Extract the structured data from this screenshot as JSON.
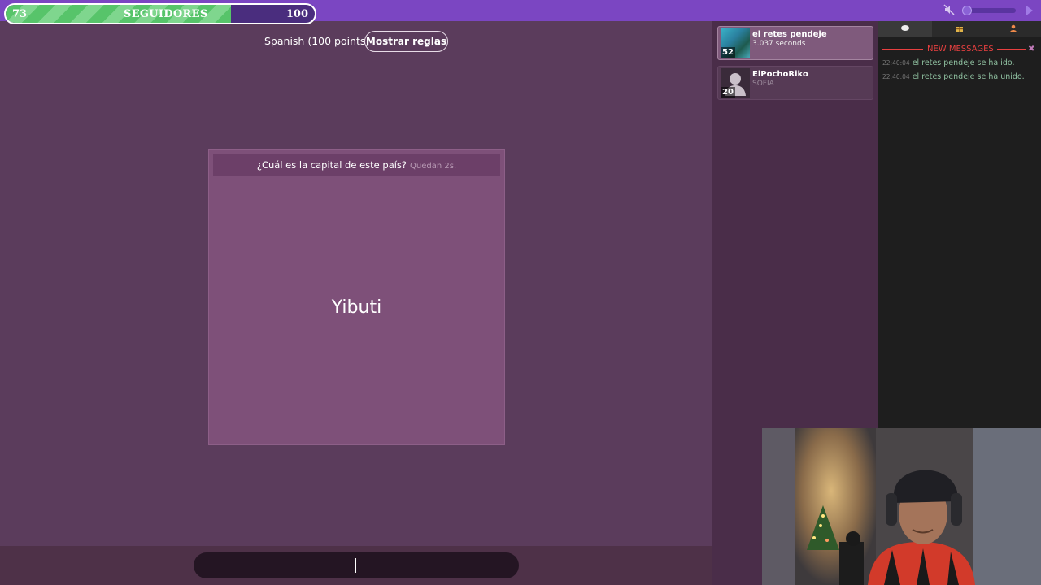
{
  "followers": {
    "label": "SEGUIDORES",
    "current": "73",
    "goal": "100",
    "progress": 0.73
  },
  "game": {
    "language_label": "Spanish (100 points)",
    "rules_button": "Mostrar reglas",
    "question": "¿Cuál es la capital de este país?",
    "timer": "Quedan 2s.",
    "answer_country": "Yibuti",
    "answer_input_value": ""
  },
  "players": [
    {
      "name": "el retes pendeje",
      "info": "3.037 seconds",
      "score": "52"
    },
    {
      "name": "ElPochoRiko",
      "info": "SOFIA",
      "score": "20"
    }
  ],
  "chat": {
    "tabs": [
      "chat-icon",
      "gift-icon",
      "people-icon"
    ],
    "new_messages_label": "NEW MESSAGES",
    "messages": [
      {
        "time": "22:40:04",
        "text": "el retes pendeje se ha ido."
      },
      {
        "time": "22:40:04",
        "text": "el retes pendeje se ha unido."
      }
    ]
  },
  "colors": {
    "topbar": "#7b46c2",
    "game_bg": "#5b3c5c",
    "card": "#7e5079",
    "progress_fill": "#57c46a",
    "new_messages": "#e84040"
  }
}
